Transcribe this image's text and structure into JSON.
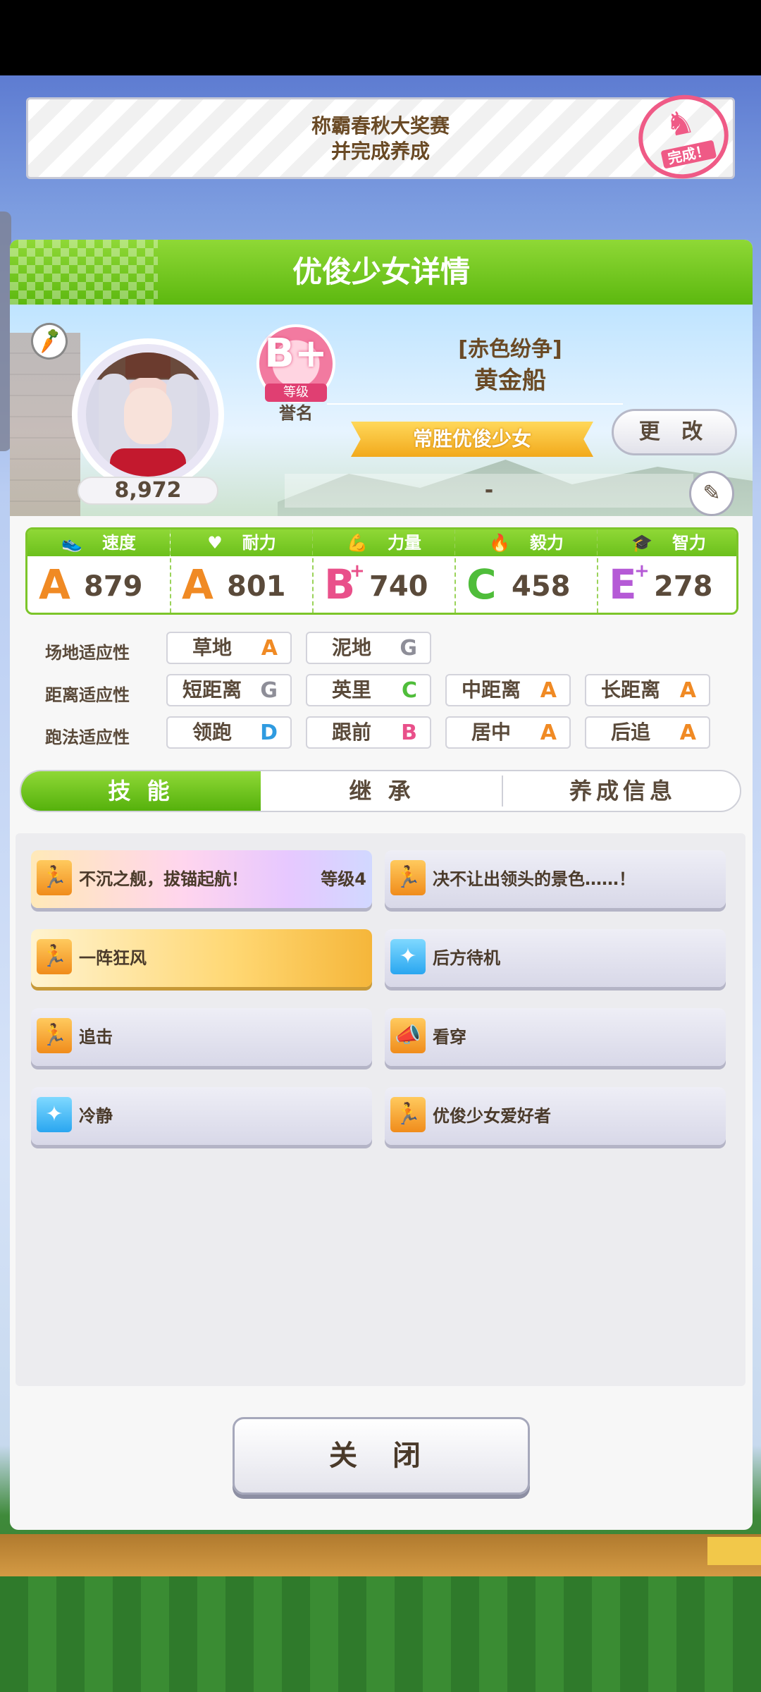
{
  "banner": {
    "line1": "称霸春秋大奖赛",
    "line2": "并完成养成",
    "stamp": "完成！"
  },
  "panel": {
    "title": "优俊少女详情"
  },
  "profile": {
    "score": "8,972",
    "rank": "B+",
    "rank_label": "等级",
    "fame_label": "誉名",
    "epithet": "[赤色纷争]",
    "name": "黄金船",
    "title_ribbon": "常胜优俊少女",
    "change_label": "更 改",
    "memo": "-"
  },
  "stats": [
    {
      "label": "速度",
      "icon": "shoe-icon",
      "grade": "A",
      "plus": "",
      "value": "879",
      "color": "#f08a24"
    },
    {
      "label": "耐力",
      "icon": "heart-icon",
      "grade": "A",
      "plus": "",
      "value": "801",
      "color": "#f08a24"
    },
    {
      "label": "力量",
      "icon": "muscle-icon",
      "grade": "B",
      "plus": "+",
      "value": "740",
      "color": "#e9508a"
    },
    {
      "label": "毅力",
      "icon": "flame-icon",
      "grade": "C",
      "plus": "",
      "value": "458",
      "color": "#4fbd3a"
    },
    {
      "label": "智力",
      "icon": "graduation-cap-icon",
      "grade": "E",
      "plus": "+",
      "value": "278",
      "color": "#b55ad6"
    }
  ],
  "aptitudes": {
    "track_label": "场地适应性",
    "distance_label": "距离适应性",
    "style_label": "跑法适应性",
    "track": [
      {
        "name": "草地",
        "grade": "A"
      },
      {
        "name": "泥地",
        "grade": "G"
      }
    ],
    "distance": [
      {
        "name": "短距离",
        "grade": "G"
      },
      {
        "name": "英里",
        "grade": "C"
      },
      {
        "name": "中距离",
        "grade": "A"
      },
      {
        "name": "长距离",
        "grade": "A"
      }
    ],
    "style": [
      {
        "name": "领跑",
        "grade": "D"
      },
      {
        "name": "跟前",
        "grade": "B"
      },
      {
        "name": "居中",
        "grade": "A"
      },
      {
        "name": "后追",
        "grade": "A"
      }
    ]
  },
  "tabs": [
    {
      "label": "技 能",
      "active": true
    },
    {
      "label": "继 承",
      "active": false
    },
    {
      "label": "养成信息",
      "active": false
    }
  ],
  "skills": [
    {
      "name": "不沉之舰，拔锚起航！",
      "level": "等级4",
      "icon": "runner-icon"
    },
    {
      "name": "决不让出领头的景色……！",
      "level": "",
      "icon": "runner-icon"
    },
    {
      "name": "一阵狂风",
      "level": "",
      "icon": "runner-icon"
    },
    {
      "name": "后方待机",
      "level": "",
      "icon": "sparkle-icon"
    },
    {
      "name": "追击",
      "level": "",
      "icon": "runner-icon"
    },
    {
      "name": "看穿",
      "level": "",
      "icon": "megaphone-icon"
    },
    {
      "name": "冷静",
      "level": "",
      "icon": "sparkle-icon"
    },
    {
      "name": "优俊少女爱好者",
      "level": "",
      "icon": "runner-icon"
    }
  ],
  "close_label": "关 闭",
  "grade_colors": {
    "A": "#f08a24",
    "B": "#e9508a",
    "C": "#4fbd3a",
    "D": "#2f9be0",
    "G": "#8e8e98"
  }
}
